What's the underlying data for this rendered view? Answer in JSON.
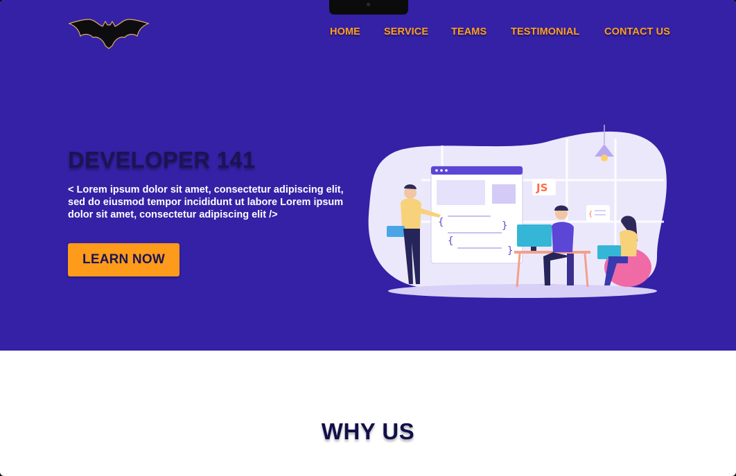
{
  "nav": {
    "home": "HOME",
    "service": "SERVICE",
    "teams": "TEAMS",
    "testimonial": "TESTIMONIAL",
    "contact": "CONTACT US"
  },
  "logo": {
    "icon": "bat-logo-icon"
  },
  "hero": {
    "title": "DEVELOPER 141",
    "text": "< Lorem ipsum dolor sit amet, consectetur adipiscing elit, sed do eiusmod tempor incididunt ut labore Lorem ipsum dolor sit amet, consectetur adipiscing elit />",
    "cta_label": "LEARN NOW",
    "illustration": {
      "js_badge": "JS",
      "icon": "team-coding-illustration"
    }
  },
  "why": {
    "title": "WHY US"
  },
  "colors": {
    "hero_bg": "#3421a6",
    "accent": "#ff9b1a",
    "title_dark": "#1a1454",
    "page_bg": "#ffffff"
  }
}
